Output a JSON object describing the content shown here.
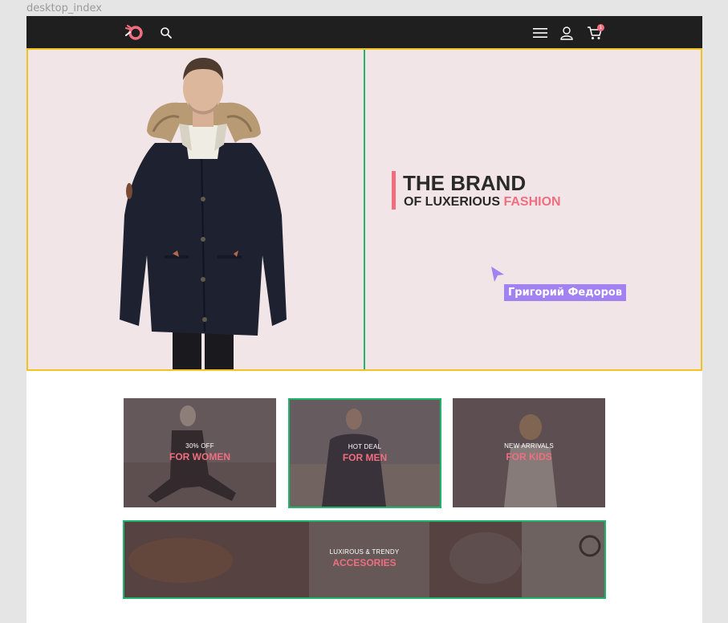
{
  "frame": {
    "label": "desktop_index"
  },
  "header": {
    "logo_icon": "logo-icon",
    "icons": [
      "search-icon",
      "hamburger-menu-icon",
      "user-icon",
      "cart-icon"
    ],
    "cart_count": "1"
  },
  "hero": {
    "title": "THE BRAND",
    "subtitle_prefix": "OF LUXERIOUS ",
    "subtitle_highlight": "FASHION"
  },
  "collaborator": {
    "name": "Григорий Федоров"
  },
  "tiles": [
    {
      "small": "30% OFF",
      "big": "FOR WOMEN"
    },
    {
      "small": "HOT DEAL",
      "big": "FOR MEN"
    },
    {
      "small": "NEW ARRIVALS",
      "big": "FOR KIDS"
    }
  ],
  "accessories": {
    "small": "LUXIROUS & TRENDY",
    "big": "ACCESORIES"
  },
  "colors": {
    "accent": "#f06e7f",
    "header_bg": "#1f1f1f",
    "hero_bg": "#f1e5e8",
    "selection_green": "#1fb46b",
    "selection_yellow": "#f2c21f",
    "collab_purple": "#a281f0"
  }
}
